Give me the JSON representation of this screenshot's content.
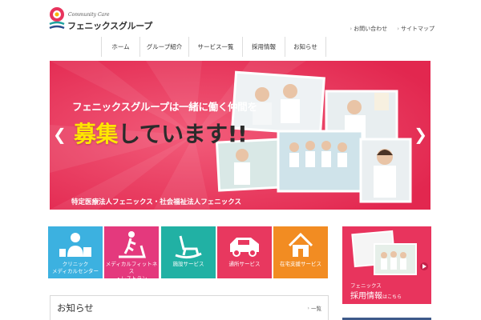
{
  "header": {
    "logo_sub": "Community Care",
    "logo_main": "フェニックスグループ",
    "util_links": [
      "お問い合わせ",
      "サイトマップ"
    ]
  },
  "nav": {
    "items": [
      "ホーム",
      "グループ紹介",
      "サービス一覧",
      "採用情報",
      "お知らせ"
    ]
  },
  "hero": {
    "line1": "フェニックスグループは一緒に働く仲間を",
    "line2a": "募集",
    "line2b": "しています!!",
    "footer": "特定医療法人フェニックス・社会福祉法人フェニックス",
    "prev_arrow": "❮",
    "next_arrow": "❯",
    "color": "#e8345d"
  },
  "tiles": [
    {
      "label": "クリニック\nメディカルセンター",
      "icon": "doctor-icon",
      "color": "#3cb1e0"
    },
    {
      "label": "メディカルフィットネス\n・レストラン",
      "icon": "treadmill-icon",
      "color": "#e4397d"
    },
    {
      "label": "施設サービス",
      "icon": "rocking-chair-icon",
      "color": "#21b1a4"
    },
    {
      "label": "通所サービス",
      "icon": "car-icon",
      "color": "#e8385f"
    },
    {
      "label": "在宅支援サービス",
      "icon": "house-icon",
      "color": "#f28c22"
    }
  ],
  "recruit": {
    "line1": "フェニックス",
    "line2": "採用情報",
    "line2_small": "はこちら",
    "color": "#e8345d"
  },
  "news": {
    "title": "お知らせ",
    "list_link": "一覧"
  }
}
